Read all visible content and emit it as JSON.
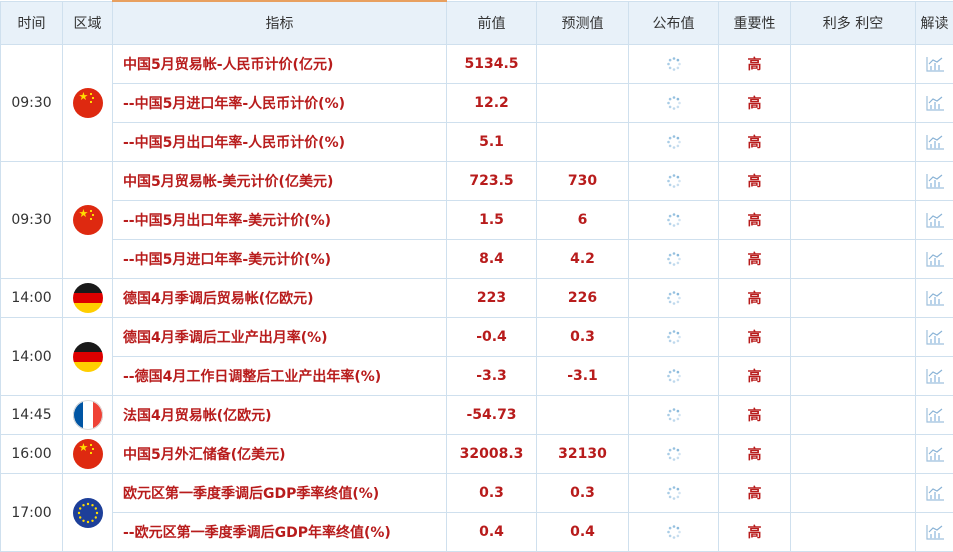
{
  "headers": [
    "时间",
    "区域",
    "指标",
    "前值",
    "预测值",
    "公布值",
    "重要性",
    "利多 利空",
    "解读"
  ],
  "rows": [
    {
      "time": "09:30",
      "flag": "cn",
      "rowspan": 3,
      "indicator": "中国5月贸易帐-人民币计价(亿元)",
      "previous": "5134.5",
      "forecast": "",
      "importance": "高"
    },
    {
      "indicator": "--中国5月进口年率-人民币计价(%)",
      "previous": "12.2",
      "forecast": "",
      "importance": "高"
    },
    {
      "indicator": "--中国5月出口年率-人民币计价(%)",
      "previous": "5.1",
      "forecast": "",
      "importance": "高"
    },
    {
      "time": "09:30",
      "flag": "cn",
      "rowspan": 3,
      "indicator": "中国5月贸易帐-美元计价(亿美元)",
      "previous": "723.5",
      "forecast": "730",
      "importance": "高"
    },
    {
      "indicator": "--中国5月出口年率-美元计价(%)",
      "previous": "1.5",
      "forecast": "6",
      "importance": "高"
    },
    {
      "indicator": "--中国5月进口年率-美元计价(%)",
      "previous": "8.4",
      "forecast": "4.2",
      "importance": "高"
    },
    {
      "time": "14:00",
      "flag": "de",
      "rowspan": 1,
      "indicator": "德国4月季调后贸易帐(亿欧元)",
      "previous": "223",
      "forecast": "226",
      "importance": "高"
    },
    {
      "time": "14:00",
      "flag": "de",
      "rowspan": 2,
      "indicator": "德国4月季调后工业产出月率(%)",
      "previous": "-0.4",
      "forecast": "0.3",
      "importance": "高"
    },
    {
      "indicator": "--德国4月工作日调整后工业产出年率(%)",
      "previous": "-3.3",
      "forecast": "-3.1",
      "importance": "高"
    },
    {
      "time": "14:45",
      "flag": "fr",
      "rowspan": 1,
      "indicator": "法国4月贸易帐(亿欧元)",
      "previous": "-54.73",
      "forecast": "",
      "importance": "高"
    },
    {
      "time": "16:00",
      "flag": "cn",
      "rowspan": 1,
      "indicator": "中国5月外汇储备(亿美元)",
      "previous": "32008.3",
      "forecast": "32130",
      "importance": "高"
    },
    {
      "time": "17:00",
      "flag": "eu",
      "rowspan": 2,
      "indicator": "欧元区第一季度季调后GDP季率终值(%)",
      "previous": "0.3",
      "forecast": "0.3",
      "importance": "高"
    },
    {
      "indicator": "--欧元区第一季度季调后GDP年率终值(%)",
      "previous": "0.4",
      "forecast": "0.4",
      "importance": "高"
    }
  ],
  "icons": {
    "actual": "loading-spinner-icon",
    "interpret": "chart-icon"
  },
  "colors": {
    "value_red": "#b81c1c",
    "header_bg": "#e8f1f9",
    "border": "#cfe0ee"
  }
}
